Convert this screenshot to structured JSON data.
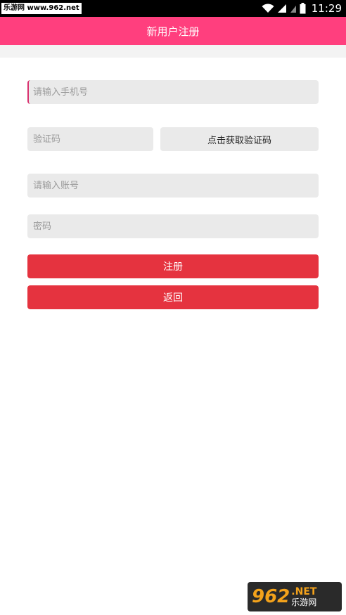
{
  "statusbar": {
    "watermark": "乐游网 www.962.net",
    "time": "11:29"
  },
  "appbar": {
    "title": "新用户注册"
  },
  "form": {
    "phone_placeholder": "请输入手机号",
    "code_placeholder": "验证码",
    "get_code_label": "点击获取验证码",
    "account_placeholder": "请输入账号",
    "password_placeholder": "密码",
    "register_label": "注册",
    "back_label": "返回"
  },
  "watermark_br": {
    "number": "962",
    "net": ".NET",
    "name": "乐游网"
  },
  "colors": {
    "appbar": "#ff3f7e",
    "primary_button": "#e5333f",
    "field_bg": "#eaeaea"
  },
  "icons": [
    "wifi-icon",
    "signal-icon",
    "battery-icon"
  ]
}
